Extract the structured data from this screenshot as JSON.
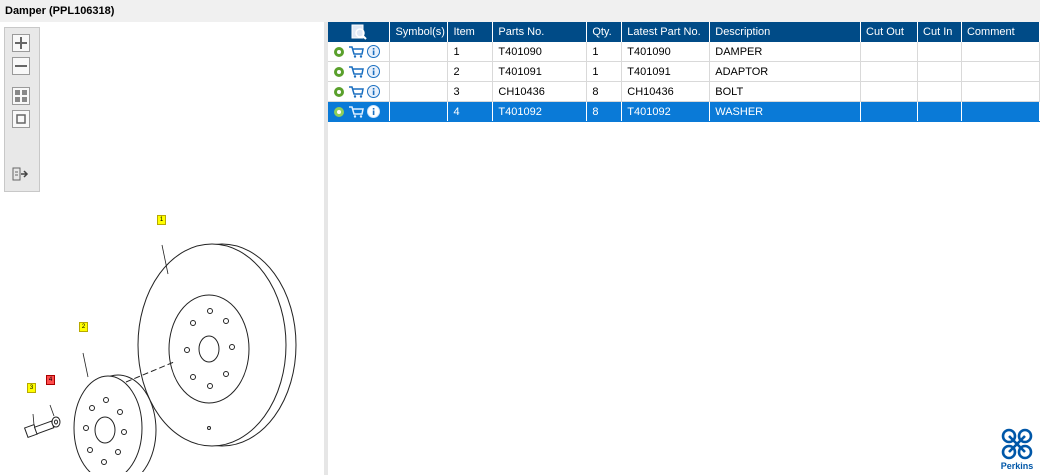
{
  "window": {
    "title": "Damper (PPL106318)"
  },
  "toolbar": {
    "buttons": [
      {
        "name": "zoom-in-button",
        "icon": "plus-icon"
      },
      {
        "name": "zoom-out-button",
        "icon": "minus-icon"
      },
      {
        "name": "fit-all-button",
        "icon": "grid-icon"
      },
      {
        "name": "actual-size-button",
        "icon": "square-icon"
      },
      {
        "name": "export-button",
        "icon": "export-arrow-icon"
      }
    ]
  },
  "drawing": {
    "callouts": [
      "1",
      "2",
      "3",
      "4"
    ],
    "callout_colors": {
      "normal": "#ffff00",
      "highlighted": "#ff4d4d"
    }
  },
  "table": {
    "headers": [
      "Symbol(s)",
      "Item",
      "Parts No.",
      "Qty.",
      "Latest Part No.",
      "Description",
      "Cut Out",
      "Cut In",
      "Comment"
    ],
    "rows": [
      {
        "symbols": "",
        "item": "1",
        "part_no": "T401090",
        "qty": "1",
        "latest": "T401090",
        "desc": "DAMPER",
        "cut_out": "",
        "cut_in": "",
        "comment": ""
      },
      {
        "symbols": "",
        "item": "2",
        "part_no": "T401091",
        "qty": "1",
        "latest": "T401091",
        "desc": "ADAPTOR",
        "cut_out": "",
        "cut_in": "",
        "comment": ""
      },
      {
        "symbols": "",
        "item": "3",
        "part_no": "CH10436",
        "qty": "8",
        "latest": "CH10436",
        "desc": "BOLT",
        "cut_out": "",
        "cut_in": "",
        "comment": ""
      },
      {
        "symbols": "",
        "item": "4",
        "part_no": "T401092",
        "qty": "8",
        "latest": "T401092",
        "desc": "WASHER",
        "cut_out": "",
        "cut_in": "",
        "comment": ""
      }
    ],
    "selected_row": 4
  },
  "brand": {
    "name": "Perkins",
    "color": "#0057a8"
  },
  "colors": {
    "header": "#004b87",
    "selection": "#0a7ad7"
  }
}
